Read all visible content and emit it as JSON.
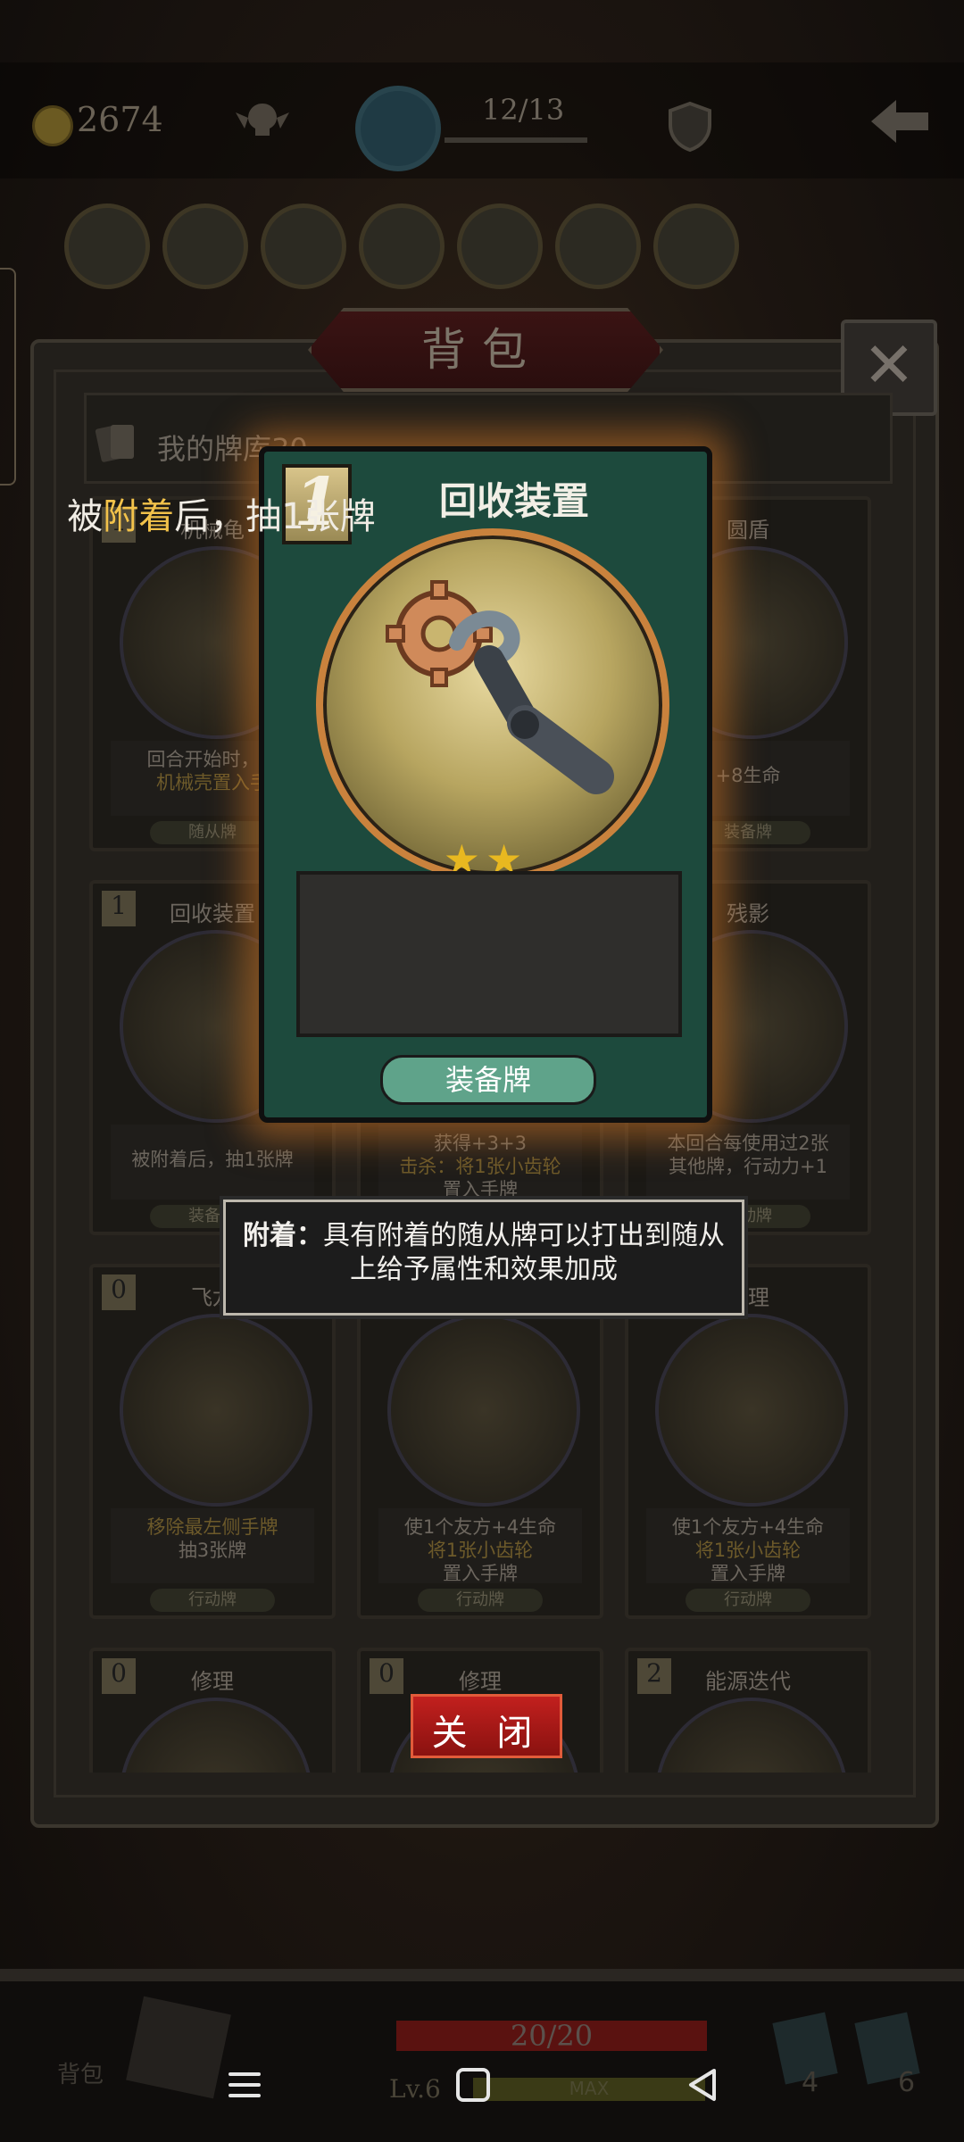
{
  "topbar": {
    "coins": "2674",
    "level_progress": "12/13",
    "level_fraction": 0.92
  },
  "backpack": {
    "title": "背包",
    "close_x": "✕",
    "deck_label": "我的牌库30"
  },
  "grid_cards": [
    {
      "cost": "1",
      "name": "机械龟",
      "desc_lines": [
        "回合开始时，将",
        "机械壳置入手"
      ],
      "type": "随从牌"
    },
    {
      "cost": "",
      "name": "",
      "desc_lines": [],
      "type": ""
    },
    {
      "cost": "",
      "name": "圆盾",
      "desc_lines": [
        "+8生命"
      ],
      "type": "装备牌"
    },
    {
      "cost": "1",
      "name": "回收装置",
      "desc_lines": [
        "被附着后，抽1张牌"
      ],
      "type": "装备牌"
    },
    {
      "cost": "",
      "name": "",
      "desc_lines": [
        "获得+3+3",
        "击杀：将1张小齿轮",
        "置入手牌"
      ],
      "type": ""
    },
    {
      "cost": "",
      "name": "残影",
      "desc_lines": [
        "本回合每使用过2张",
        "其他牌，行动力+1"
      ],
      "type": "行动牌"
    },
    {
      "cost": "0",
      "name": "飞龙",
      "desc_lines": [
        "移除最左侧手牌",
        "抽3张牌"
      ],
      "type": "行动牌"
    },
    {
      "cost": "",
      "name": "",
      "desc_lines": [
        "使1个友方+4生命",
        "将1张小齿轮",
        "置入手牌"
      ],
      "type": "行动牌"
    },
    {
      "cost": "",
      "name": "修理",
      "desc_lines": [
        "使1个友方+4生命",
        "将1张小齿轮",
        "置入手牌"
      ],
      "type": "行动牌"
    },
    {
      "cost": "0",
      "name": "修理",
      "desc_lines": [],
      "type": ""
    },
    {
      "cost": "0",
      "name": "修理",
      "desc_lines": [],
      "type": ""
    },
    {
      "cost": "2",
      "name": "能源迭代",
      "desc_lines": [],
      "type": ""
    }
  ],
  "selected_card": {
    "cost": "1",
    "name": "回收装置",
    "stars": "★★",
    "star_count": 2,
    "desc_prefix": "被",
    "desc_highlight": "附着",
    "desc_suffix": "后，抽1张牌",
    "type": "装备牌",
    "accent": "#1d4a3d",
    "glow": "#d27828"
  },
  "tooltip": {
    "term": "附着：",
    "line1_rest": "具有附着的随从牌可以打出到随从",
    "line2": "上给予属性和效果加成"
  },
  "close_button": "关 闭",
  "bottom": {
    "bag_label": "背包",
    "hp": "20/20",
    "level": "Lv.6",
    "xp_label": "MAX",
    "count_a": "4",
    "count_b": "6"
  }
}
